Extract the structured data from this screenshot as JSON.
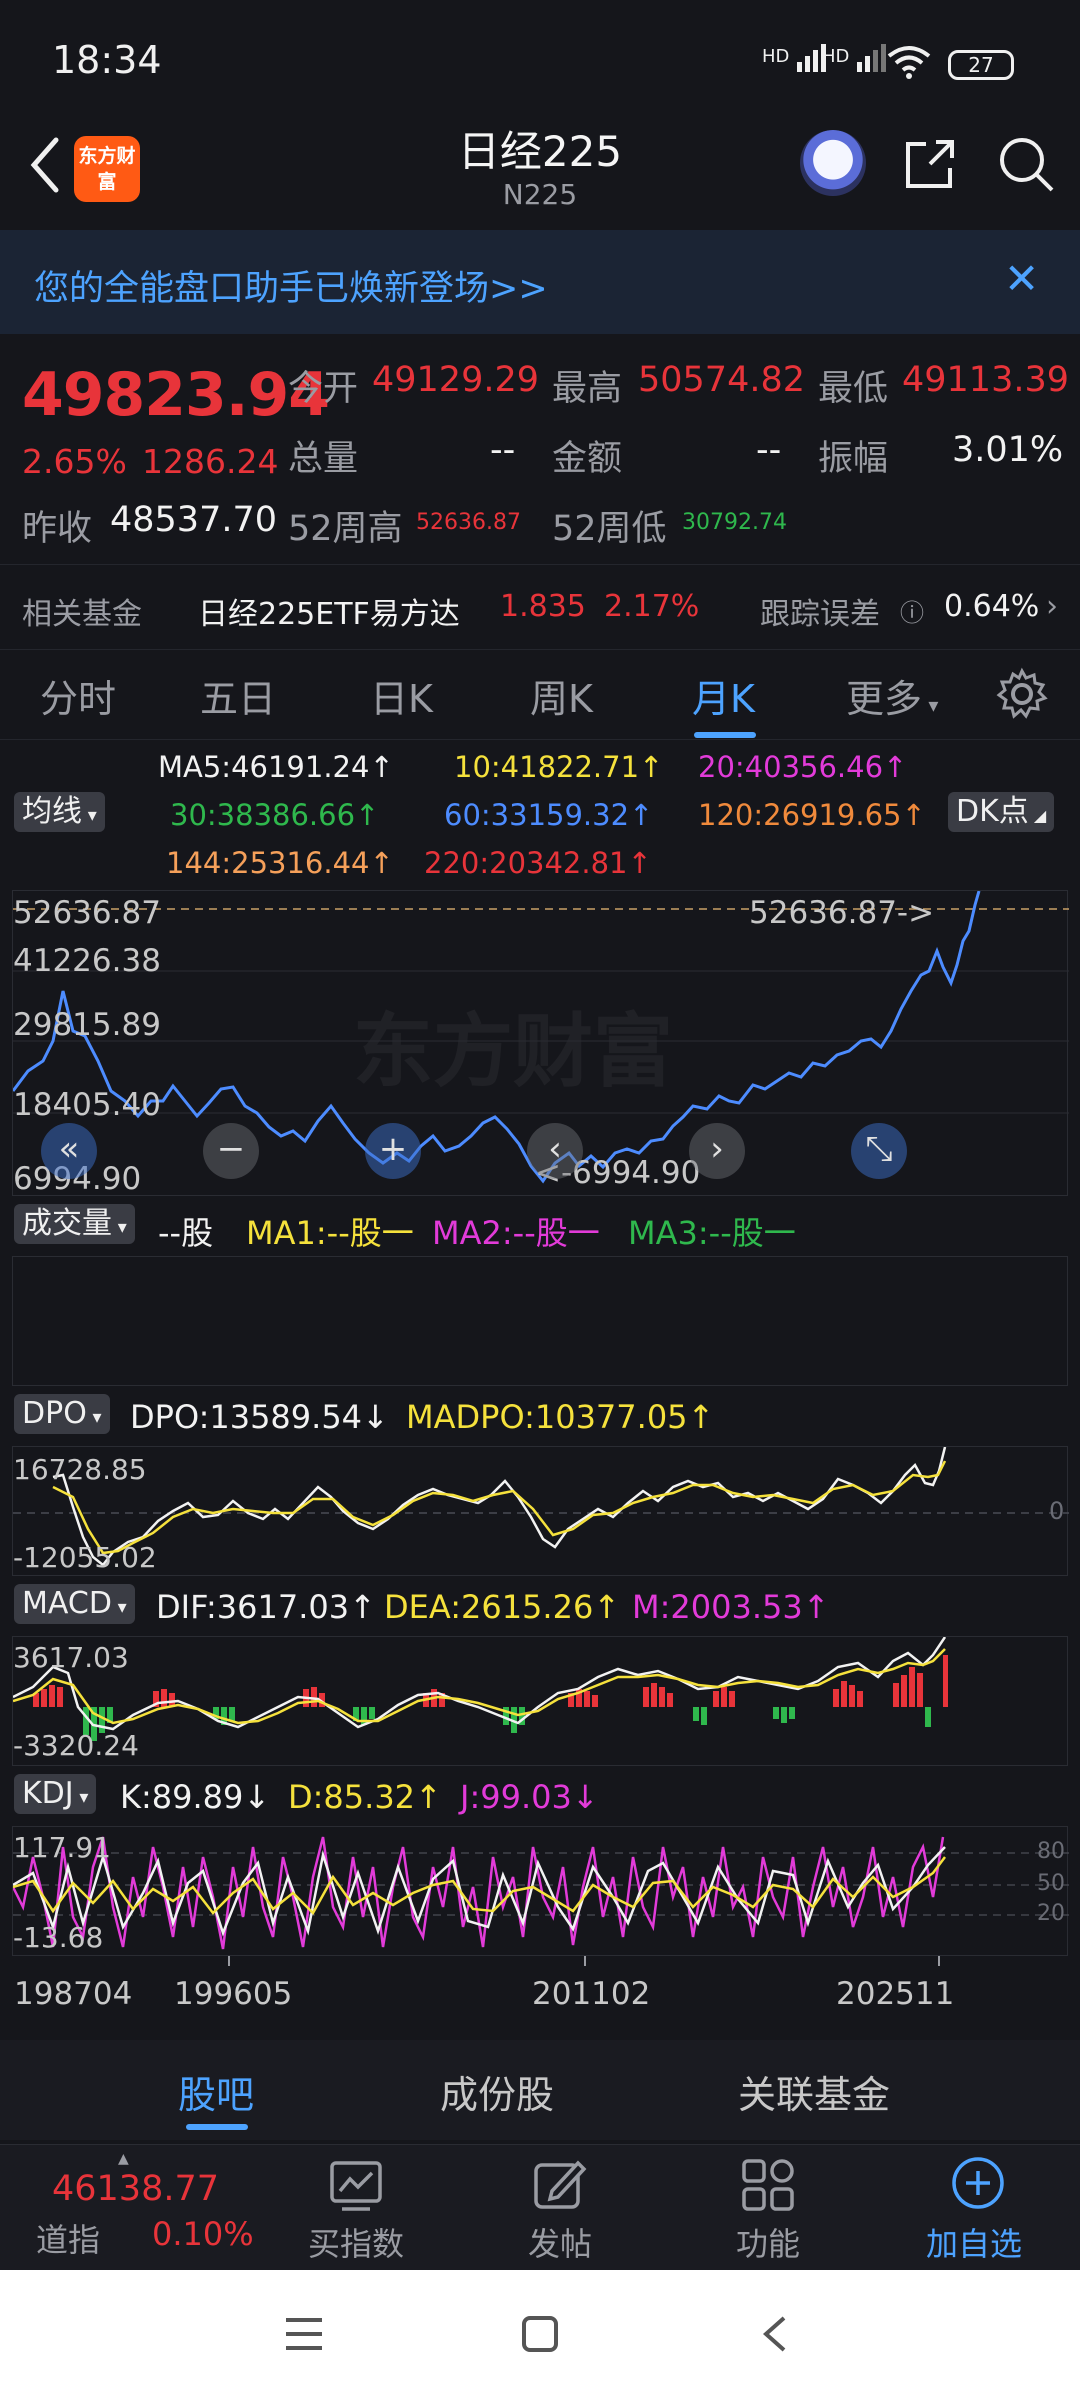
{
  "status": {
    "time": "18:34",
    "battery": "27",
    "sig1": "HD",
    "sig2": "HD"
  },
  "header": {
    "logo_text": "东方财富",
    "title": "日经225",
    "subtitle": "N225"
  },
  "banner": {
    "text": "您的全能盘口助手已焕新登场>>"
  },
  "quote": {
    "price": "49823.94",
    "change_pct": "2.65%",
    "change": "1286.24",
    "open_label": "今开",
    "open": "49129.29",
    "high_label": "最高",
    "high": "50574.82",
    "low_label": "最低",
    "low": "49113.39",
    "volume_label": "总量",
    "volume": "--",
    "amount_label": "金额",
    "amount": "--",
    "amplitude_label": "振幅",
    "amplitude": "3.01%",
    "prev_close_label": "昨收",
    "prev_close": "48537.70",
    "w52_high_label": "52周高",
    "w52_high": "52636.87",
    "w52_low_label": "52周低",
    "w52_low": "30792.74"
  },
  "fund": {
    "label": "相关基金",
    "name": "日经225ETF易方达",
    "price": "1.835",
    "pct": "2.17%",
    "err_label": "跟踪误差",
    "err": "0.64%"
  },
  "tabs": [
    "分时",
    "五日",
    "日K",
    "周K",
    "月K",
    "更多"
  ],
  "ma": {
    "selector": "均线",
    "dk": "DK点",
    "items": [
      {
        "text": "MA5:46191.24↑",
        "color": "#f2f2f2"
      },
      {
        "text": "10:41822.71↑",
        "color": "#f5e13c"
      },
      {
        "text": "20:40356.46↑",
        "color": "#e23bd9"
      },
      {
        "text": "30:38386.66↑",
        "color": "#2fb84d"
      },
      {
        "text": "60:33159.32↑",
        "color": "#4d8cff"
      },
      {
        "text": "120:26919.65↑",
        "color": "#f08a3c"
      },
      {
        "text": "144:25316.44↑",
        "color": "#f5a05a"
      },
      {
        "text": "220:20342.81↑",
        "color": "#e8343a"
      }
    ]
  },
  "main_chart": {
    "y_labels": [
      "52636.87",
      "41226.38",
      "29815.89",
      "18405.40",
      "6994.90"
    ],
    "max_marker": "52636.87->",
    "min_marker": "<-6994.90",
    "watermark": "东方财富"
  },
  "volume": {
    "selector": "成交量",
    "unit": "--股",
    "ma1": "MA1:--股一",
    "ma2": "MA2:--股一",
    "ma3": "MA3:--股一"
  },
  "dpo": {
    "selector": "DPO",
    "dpo": "DPO:13589.54↓",
    "madpo": "MADPO:10377.05↑",
    "y_top": "16728.85",
    "y_bottom": "-12055.02",
    "zero": "0"
  },
  "macd": {
    "selector": "MACD",
    "dif": "DIF:3617.03↑",
    "dea": "DEA:2615.26↑",
    "m": "M:2003.53↑",
    "y_top": "3617.03",
    "y_bottom": "-3320.24"
  },
  "kdj": {
    "selector": "KDJ",
    "k": "K:89.89↓",
    "d": "D:85.32↑",
    "j": "J:99.03↓",
    "y_top": "117.91",
    "y_bottom": "-13.68",
    "levels": [
      "80",
      "50",
      "20"
    ]
  },
  "x_axis": [
    "198704",
    "199605",
    "201102",
    "202511"
  ],
  "subtabs": [
    "股吧",
    "成份股",
    "关联基金"
  ],
  "bottom": {
    "index_value": "46138.77",
    "index_name": "道指",
    "index_pct": "0.10%",
    "buy": "买指数",
    "post": "发帖",
    "func": "功能",
    "add": "加自选"
  },
  "colors": {
    "up": "#e8343a",
    "down": "#2fb84d",
    "accent": "#4da3ff",
    "price_line": "#4d8cff"
  }
}
